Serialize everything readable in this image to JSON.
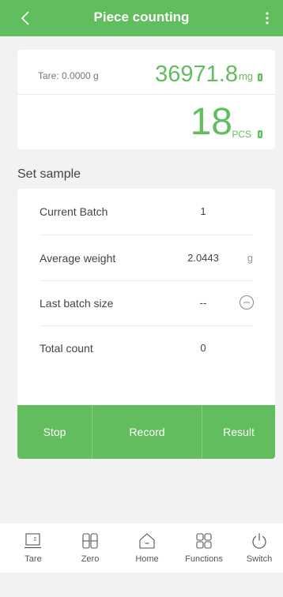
{
  "header": {
    "title": "Piece counting",
    "back_icon": "chevron-left-icon",
    "menu_icon": "more-vertical-icon",
    "color": "#62bd5f"
  },
  "readout": {
    "tare": "Tare: 0.0000 g",
    "weight": "36971.8",
    "weight_unit": "mg",
    "count": "18",
    "count_unit": "PCS"
  },
  "sample": {
    "section_title": "Set sample",
    "rows": [
      {
        "label": "Current Batch",
        "value": "1",
        "unit": ""
      },
      {
        "label": "Average weight",
        "value": "2.0443",
        "unit": "g"
      },
      {
        "label": "Last batch size",
        "value": "--",
        "unit": ""
      },
      {
        "label": "Total count",
        "value": "0",
        "unit": ""
      }
    ],
    "actions": [
      "Stop",
      "Record",
      "Result"
    ]
  },
  "nav": {
    "items": [
      {
        "label": "Tare",
        "icon": "tare-icon"
      },
      {
        "label": "Zero",
        "icon": "zero-icon"
      },
      {
        "label": "Home",
        "icon": "home-icon"
      },
      {
        "label": "Functions",
        "icon": "functions-icon"
      },
      {
        "label": "Switch",
        "icon": "power-icon"
      }
    ]
  }
}
